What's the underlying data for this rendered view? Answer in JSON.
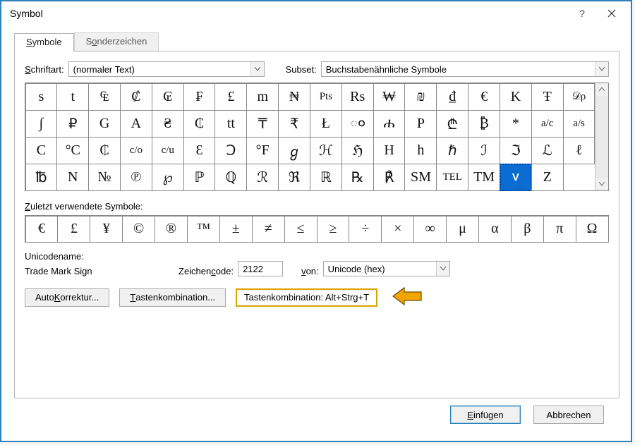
{
  "dialog": {
    "title": "Symbol"
  },
  "tabs": {
    "symbols": "Symbole",
    "special": "Sonderzeichen"
  },
  "fontRow": {
    "label": "Schriftart:",
    "value": "(normaler Text)",
    "subsetLabel": "Subset:",
    "subsetValue": "Buchstabenähnliche Symbole"
  },
  "grid": [
    "s",
    "t",
    "₠",
    "₡",
    "₢",
    "₣",
    "£",
    "m",
    "₦",
    "Pts",
    "Rs",
    "₩",
    "₪",
    "₫",
    "€",
    "K",
    "Ŧ",
    "𝒟ρ",
    "∫",
    "₽",
    "G",
    "A",
    "₴",
    "₵",
    "tt",
    "₸",
    "₹",
    "Ł",
    "ం",
    "ሐ",
    "P",
    "₾",
    "₿",
    "*",
    "a/c",
    "a/s",
    "C",
    "°C",
    "₵",
    "c/o",
    "c/u",
    "Ɛ",
    "Ↄ",
    "°F",
    "ℊ",
    "ℋ",
    "ℌ",
    "H",
    "h",
    "ℏ",
    "ℐ",
    "ℑ",
    "ℒ",
    "ℓ",
    "℔",
    "N",
    "№",
    "℗",
    "℘",
    "ℙ",
    "ℚ",
    "ℛ",
    "ℜ",
    "ℝ",
    "℞",
    "℟",
    "SM",
    "TEL",
    "TM",
    "V",
    "Z"
  ],
  "gridSelectedIndex": 69,
  "recentLabel": "Zuletzt verwendete Symbole:",
  "recent": [
    "€",
    "£",
    "¥",
    "©",
    "®",
    "™",
    "±",
    "≠",
    "≤",
    "≥",
    "÷",
    "×",
    "∞",
    "μ",
    "α",
    "β",
    "π",
    "Ω"
  ],
  "unicode": {
    "nameLabel": "Unicodename:",
    "nameValue": "Trade Mark Sign",
    "codeLabel": "Zeichencode:",
    "codeValue": "2122",
    "fromLabel": "von:",
    "fromValue": "Unicode (hex)"
  },
  "buttons": {
    "autocorrect": "AutoKorrektur...",
    "shortcutBtn": "Tastenkombination...",
    "shortcutLabel": "Tastenkombination: Alt+Strg+T",
    "insert": "Einfügen",
    "cancel": "Abbrechen"
  }
}
